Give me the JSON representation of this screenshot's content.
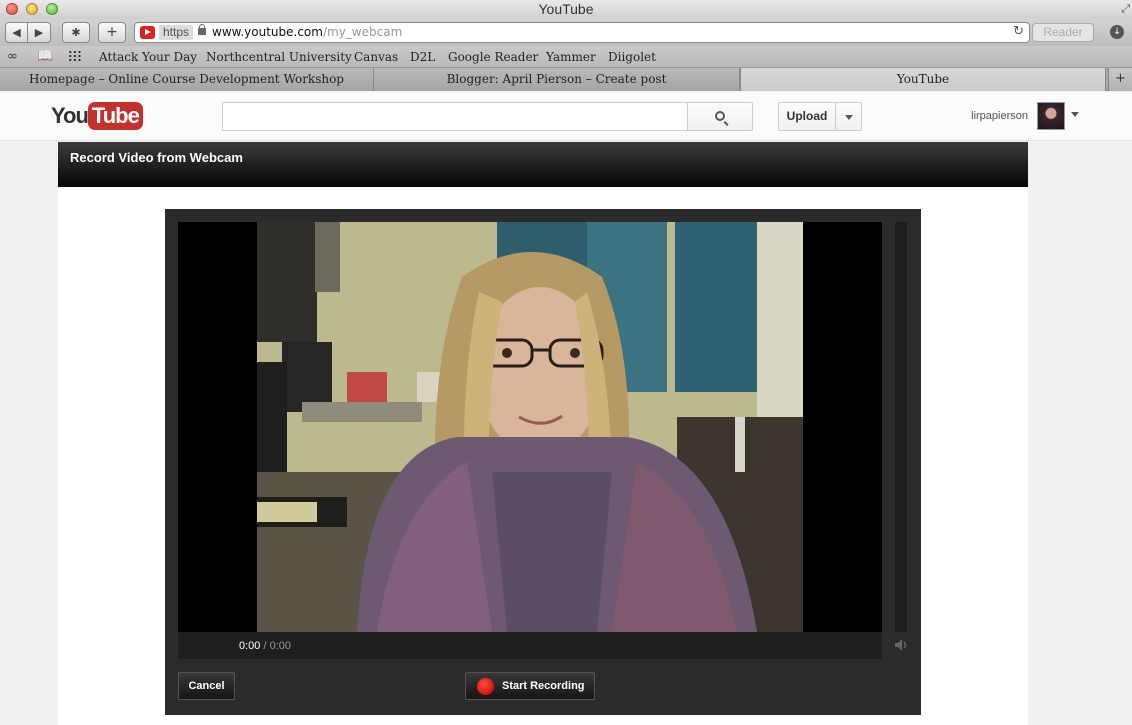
{
  "window": {
    "title": "YouTube"
  },
  "toolbar": {
    "url_protocol": "https",
    "url_host": "www.youtube.com",
    "url_path": "/my_webcam",
    "reader_label": "Reader"
  },
  "bookmarks": [
    "Attack Your Day",
    "Northcentral University",
    "Canvas",
    "D2L",
    "Google Reader",
    "Yammer",
    "Diigolet"
  ],
  "tabs": [
    {
      "label": "Homepage – Online Course Development Workshop",
      "active": false
    },
    {
      "label": "Blogger: April Pierson – Create post",
      "active": false
    },
    {
      "label": "YouTube",
      "active": true
    }
  ],
  "youtube": {
    "logo_you": "You",
    "logo_tube": "Tube",
    "search_placeholder": "",
    "upload_label": "Upload",
    "username": "lirpapierson"
  },
  "recorder": {
    "panel_title": "Record Video from Webcam",
    "time_current": "0:00",
    "time_separator": " / ",
    "time_total": "0:00",
    "cancel_label": "Cancel",
    "record_label": "Start Recording"
  },
  "colors": {
    "youtube_red": "#c4302b",
    "record_red": "#e0251b",
    "panel_header": "#1a1a1a"
  }
}
